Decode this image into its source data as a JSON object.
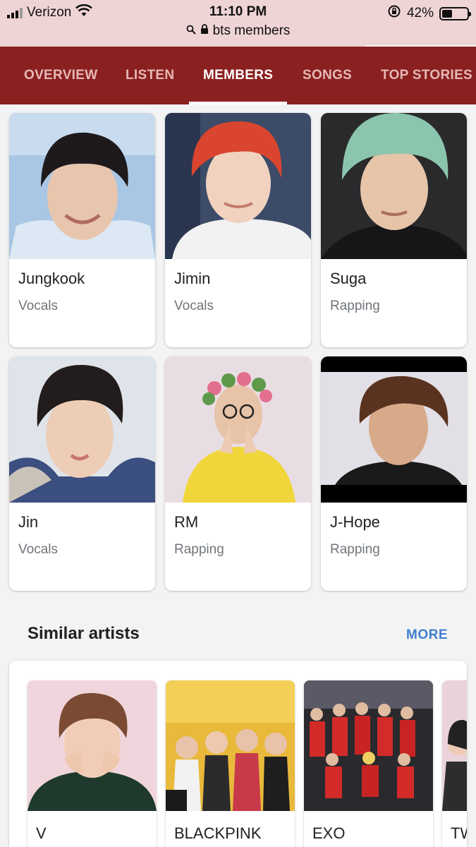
{
  "status_bar": {
    "carrier": "Verizon",
    "time": "11:10 PM",
    "battery_percent": "42%",
    "battery_level": 0.42,
    "url": "bts members"
  },
  "tabs": [
    {
      "label": "OVERVIEW",
      "active": false
    },
    {
      "label": "LISTEN",
      "active": false
    },
    {
      "label": "MEMBERS",
      "active": true
    },
    {
      "label": "SONGS",
      "active": false
    },
    {
      "label": "TOP STORIES",
      "active": false
    }
  ],
  "members": [
    {
      "name": "Jungkook",
      "role": "Vocals"
    },
    {
      "name": "Jimin",
      "role": "Vocals"
    },
    {
      "name": "Suga",
      "role": "Rapping"
    },
    {
      "name": "Jin",
      "role": "Vocals"
    },
    {
      "name": "RM",
      "role": "Rapping"
    },
    {
      "name": "J-Hope",
      "role": "Rapping"
    }
  ],
  "similar_artists": {
    "title": "Similar artists",
    "more_label": "MORE",
    "items": [
      {
        "name": "V"
      },
      {
        "name": "BLACKPINK"
      },
      {
        "name": "EXO"
      },
      {
        "name": "TW"
      }
    ]
  },
  "colors": {
    "tab_bar": "#8b2020",
    "status_bar": "#efd4d6",
    "link": "#3f7fd0"
  }
}
